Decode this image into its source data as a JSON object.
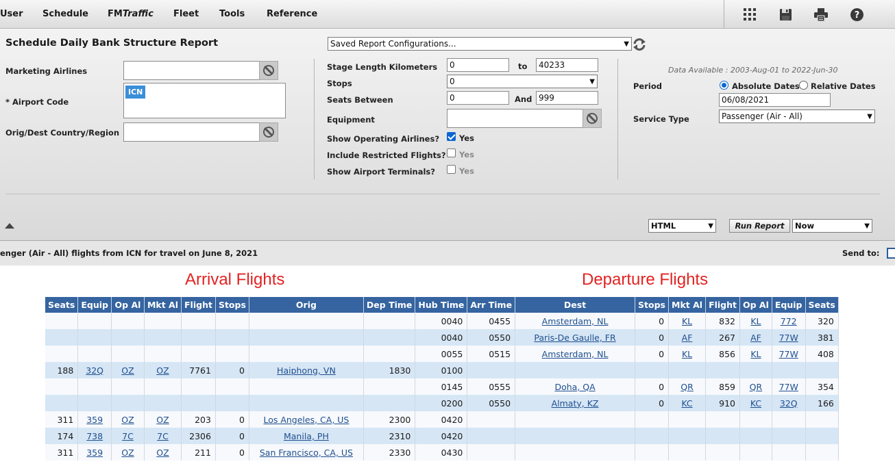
{
  "nav": {
    "items": [
      "User",
      "Schedule",
      "FM",
      "Fleet",
      "Tools",
      "Reference"
    ],
    "fm_suffix": "Traffic",
    "tools": [
      "apps-grid-icon",
      "save-icon",
      "print-icon",
      "help-icon"
    ]
  },
  "form": {
    "title": "Schedule Daily Bank Structure Report",
    "saved_config": "Saved Report Configurations...",
    "marketing_airlines_label": "Marketing Airlines",
    "airport_code_label": "* Airport Code",
    "airport_chip": "ICN",
    "orig_dest_label": "Orig/Dest Country/Region",
    "stage_length_label": "Stage Length Kilometers",
    "stage_from": "0",
    "to_label": "to",
    "stage_to": "40233",
    "stops_label": "Stops",
    "stops_value": "0",
    "seats_between_label": "Seats Between",
    "seats_from": "0",
    "and_label": "And",
    "seats_to": "999",
    "equipment_label": "Equipment",
    "show_op_label": "Show Operating Airlines?",
    "include_restricted_label": "Include Restricted Flights?",
    "show_terminals_label": "Show Airport Terminals?",
    "yes": "Yes",
    "data_available": "Data Available :  2003-Aug-01 to 2022-Jun-30",
    "period_label": "Period",
    "absolute_dates": "Absolute Dates",
    "relative_dates": "Relative Dates",
    "date_value": "06/08/2021",
    "service_type_label": "Service Type",
    "service_type_value": "Passenger (Air - All)",
    "format_value": "HTML",
    "run_report": "Run Report",
    "when_value": "Now"
  },
  "info": {
    "summary": "enger (Air - All) flights from ICN for travel on June 8, 2021",
    "send_to": "Send to:"
  },
  "sections": {
    "arrival": "Arrival Flights",
    "departure": "Departure Flights"
  },
  "table": {
    "headers": [
      "Seats",
      "Equip",
      "Op Al",
      "Mkt Al",
      "Flight",
      "Stops",
      "Orig",
      "Dep Time",
      "Hub Time",
      "Arr Time",
      "Dest",
      "Stops",
      "Mkt Al",
      "Flight",
      "Op Al",
      "Equip",
      "Seats"
    ],
    "rows": [
      [
        "",
        "",
        "",
        "",
        "",
        "",
        "",
        "",
        "0040",
        "0455",
        "Amsterdam, NL",
        "0",
        "KL",
        "832",
        "KL",
        "772",
        "320"
      ],
      [
        "",
        "",
        "",
        "",
        "",
        "",
        "",
        "",
        "0040",
        "0550",
        "Paris-De Gaulle, FR",
        "0",
        "AF",
        "267",
        "AF",
        "77W",
        "381"
      ],
      [
        "",
        "",
        "",
        "",
        "",
        "",
        "",
        "",
        "0055",
        "0515",
        "Amsterdam, NL",
        "0",
        "KL",
        "856",
        "KL",
        "77W",
        "408"
      ],
      [
        "188",
        "32Q",
        "OZ",
        "OZ",
        "7761",
        "0",
        "Haiphong, VN",
        "1830",
        "0100",
        "",
        "",
        "",
        "",
        "",
        "",
        "",
        ""
      ],
      [
        "",
        "",
        "",
        "",
        "",
        "",
        "",
        "",
        "0145",
        "0555",
        "Doha, QA",
        "0",
        "QR",
        "859",
        "QR",
        "77W",
        "354"
      ],
      [
        "",
        "",
        "",
        "",
        "",
        "",
        "",
        "",
        "0200",
        "0550",
        "Almaty, KZ",
        "0",
        "KC",
        "910",
        "KC",
        "32Q",
        "166"
      ],
      [
        "311",
        "359",
        "OZ",
        "OZ",
        "203",
        "0",
        "Los Angeles, CA, US",
        "2300",
        "0420",
        "",
        "",
        "",
        "",
        "",
        "",
        "",
        ""
      ],
      [
        "174",
        "738",
        "7C",
        "7C",
        "2306",
        "0",
        "Manila, PH",
        "2310",
        "0420",
        "",
        "",
        "",
        "",
        "",
        "",
        "",
        ""
      ],
      [
        "311",
        "359",
        "OZ",
        "OZ",
        "211",
        "0",
        "San Francisco, CA, US",
        "2330",
        "0430",
        "",
        "",
        "",
        "",
        "",
        "",
        "",
        ""
      ]
    ]
  }
}
